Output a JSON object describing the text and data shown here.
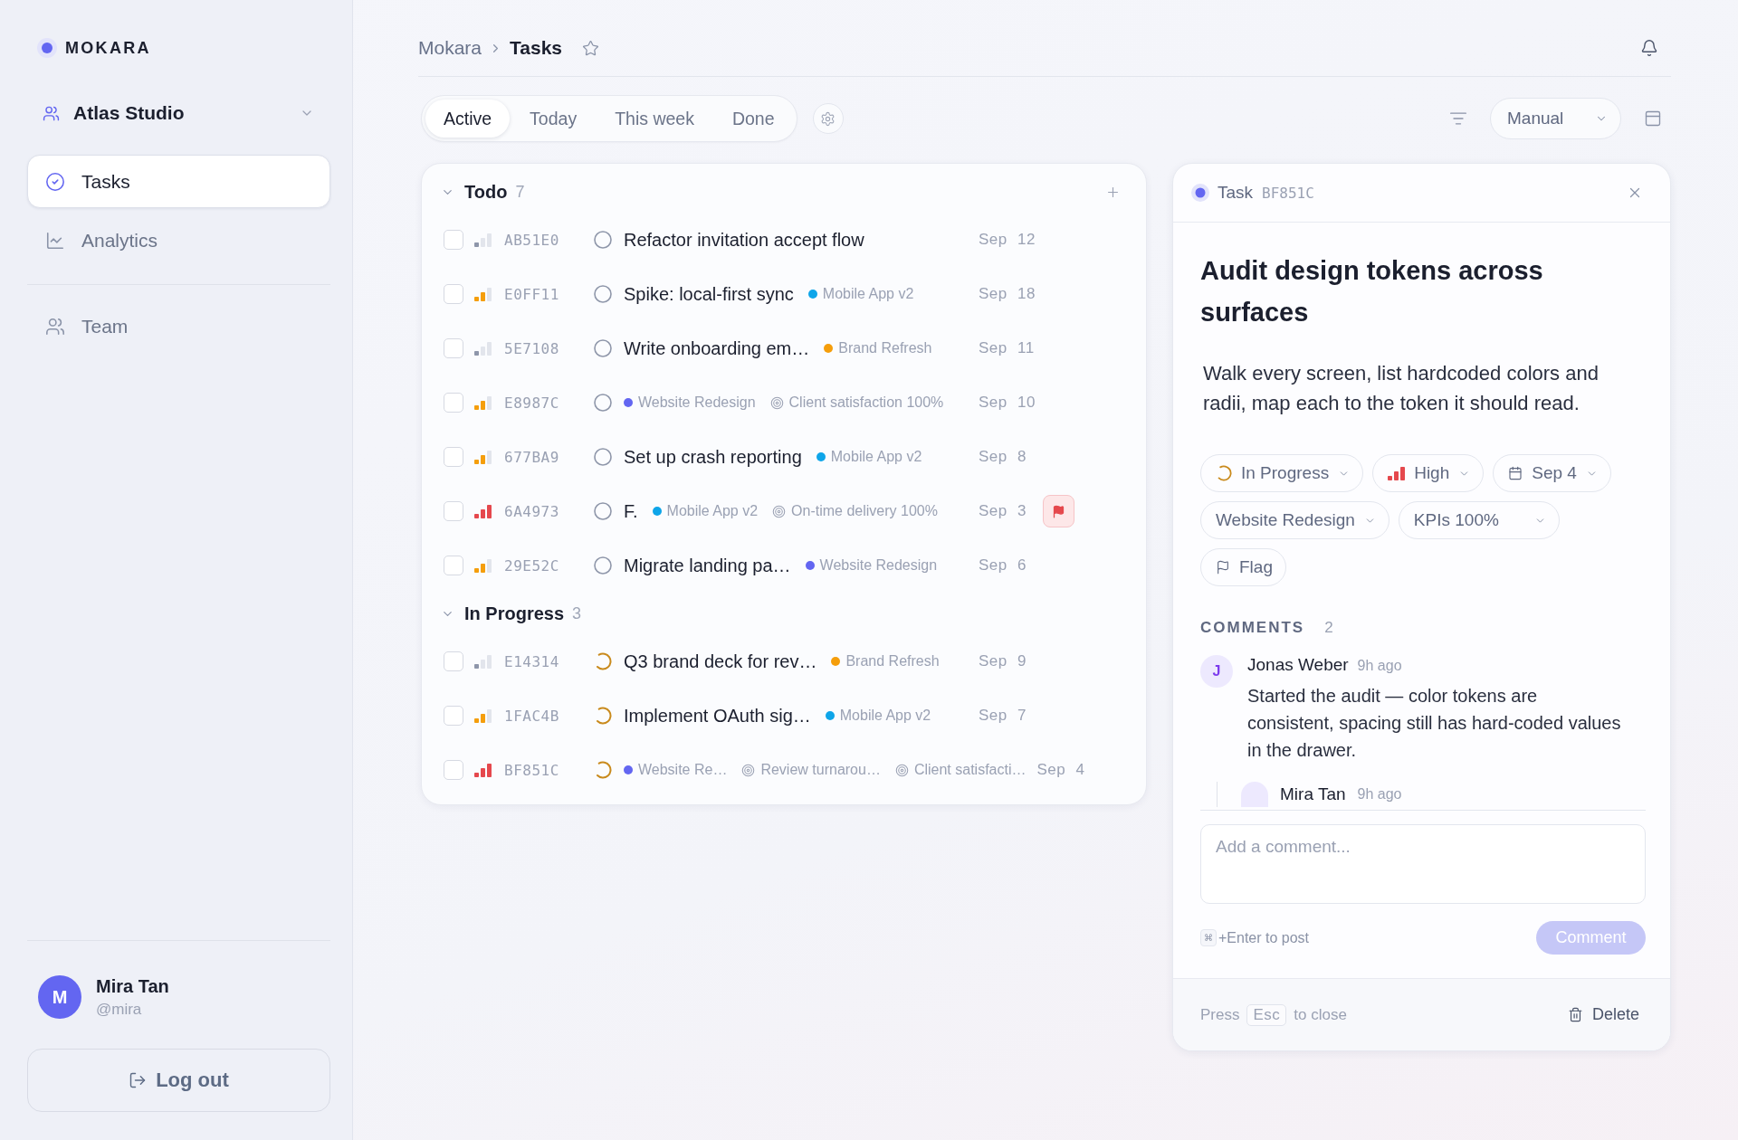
{
  "sidebar": {
    "brand": "MOKARA",
    "workspace": "Atlas Studio",
    "nav": [
      {
        "kind": "tasks",
        "label": "Tasks",
        "selected": true
      },
      {
        "kind": "analytics",
        "label": "Analytics",
        "selected": false
      }
    ],
    "secondary_nav": [
      {
        "kind": "team",
        "label": "Team",
        "selected": false
      }
    ],
    "user": {
      "initial": "M",
      "name": "Mira Tan",
      "handle": "@mira"
    },
    "logout": "Log out"
  },
  "header": {
    "breadcrumb": [
      "Mokara",
      "Tasks"
    ],
    "starred": false
  },
  "toolbar": {
    "tabs": [
      {
        "label": "Active",
        "selected": true
      },
      {
        "label": "Today",
        "selected": false
      },
      {
        "label": "This week",
        "selected": false
      },
      {
        "label": "Done",
        "selected": false
      }
    ],
    "sort": "Manual"
  },
  "task_list": {
    "groups": [
      {
        "kind": "todo",
        "title": "Todo",
        "count": "7",
        "expanded": true,
        "add_button": true,
        "tasks": [
          {
            "id": "AB51E0",
            "level": 0.33,
            "checked": false,
            "title": "Refactor invitation accept flow",
            "date": "Sep 12",
            "flagged": false
          },
          {
            "id": "E0FF11",
            "level": 0.67,
            "checked": false,
            "title": "Spike: local-first sync",
            "tags": [
              {
                "kind": "project",
                "label": "Mobile App v2",
                "color": "#0ea5e9"
              }
            ],
            "date": "Sep 18",
            "flagged": false
          },
          {
            "id": "5E7108",
            "level": 0.33,
            "checked": false,
            "title": "Write onboarding em…",
            "tags": [
              {
                "kind": "project",
                "label": "Brand Refresh",
                "color": "#f59e0b"
              }
            ],
            "date": "Sep 11",
            "flagged": false
          },
          {
            "id": "E8987C",
            "level": 0.67,
            "checked": false,
            "tags": [
              {
                "kind": "project",
                "label": "Website Redesign",
                "color": "#6366f1"
              },
              {
                "kind": "kpi",
                "label": "Client satisfaction 100%"
              }
            ],
            "date": "Sep 10",
            "flagged": false
          },
          {
            "id": "677BA9",
            "level": 0.67,
            "checked": false,
            "title": "Set up crash reporting",
            "tags": [
              {
                "kind": "project",
                "label": "Mobile App v2",
                "color": "#0ea5e9"
              }
            ],
            "date": "Sep 8",
            "flagged": false
          },
          {
            "id": "6A4973",
            "level": 1,
            "checked": false,
            "title": "F.",
            "tags": [
              {
                "kind": "project",
                "label": "Mobile App v2",
                "color": "#0ea5e9"
              },
              {
                "kind": "kpi",
                "label": "On-time delivery 100%"
              }
            ],
            "date": "Sep 3",
            "flagged": true
          },
          {
            "id": "29E52C",
            "level": 0.67,
            "checked": false,
            "title": "Migrate landing pa…",
            "tags": [
              {
                "kind": "project",
                "label": "Website Redesign",
                "color": "#6366f1"
              }
            ],
            "date": "Sep 6",
            "flagged": false
          }
        ]
      },
      {
        "kind": "in_progress",
        "title": "In Progress",
        "count": "3",
        "expanded": true,
        "add_button": false,
        "tasks": [
          {
            "id": "E14314",
            "level": 0.33,
            "checked": false,
            "title": "Q3 brand deck for rev…",
            "tags": [
              {
                "kind": "project",
                "label": "Brand Refresh",
                "color": "#f59e0b"
              }
            ],
            "date": "Sep 9",
            "flagged": false
          },
          {
            "id": "1FAC4B",
            "level": 0.67,
            "checked": false,
            "title": "Implement OAuth sig…",
            "tags": [
              {
                "kind": "project",
                "label": "Mobile App v2",
                "color": "#0ea5e9"
              }
            ],
            "date": "Sep 7",
            "flagged": false
          },
          {
            "id": "BF851C",
            "level": 1,
            "checked": false,
            "tags": [
              {
                "kind": "project",
                "label": "Website Re…",
                "color": "#6366f1"
              },
              {
                "kind": "kpi",
                "label": "Review turnarou…"
              },
              {
                "kind": "kpi",
                "label": "Client satisfacti…"
              }
            ],
            "date": "Sep 4",
            "flagged": false
          }
        ]
      }
    ]
  },
  "detail": {
    "label": "Task",
    "id": "BF851C",
    "title": "Audit design tokens across surfaces",
    "description": "Walk every screen, list hardcoded colors and radii, map each to the token it should read.",
    "properties": [
      {
        "kind": "status",
        "label": "In Progress"
      },
      {
        "kind": "priority",
        "label": "High",
        "level": 1
      },
      {
        "kind": "date",
        "label": "Sep 4"
      },
      {
        "kind": "project",
        "label": "Website Redesign"
      },
      {
        "kind": "kpi",
        "label": "KPIs 100%"
      },
      {
        "kind": "flag",
        "label": "Flag",
        "flagged": false
      }
    ],
    "comments": {
      "title": "COMMENTS",
      "count": "2",
      "items": [
        {
          "initial": "J",
          "author": "Jonas Weber",
          "time": "9h ago",
          "text": "Started the audit — color tokens are consistent, spacing still has hard-coded values in the drawer.",
          "replies": [
            {
              "author": "Mira Tan",
              "time": "9h ago"
            }
          ]
        }
      ]
    },
    "composer": {
      "placeholder": "Add a comment...",
      "shortcut_key": "⌘",
      "shortcut_hint": "+Enter to post",
      "submit": "Comment",
      "submit_disabled": true
    },
    "footer": {
      "hint_before": "Press",
      "key": "Esc",
      "hint_after": "to close",
      "delete": "Delete"
    }
  }
}
